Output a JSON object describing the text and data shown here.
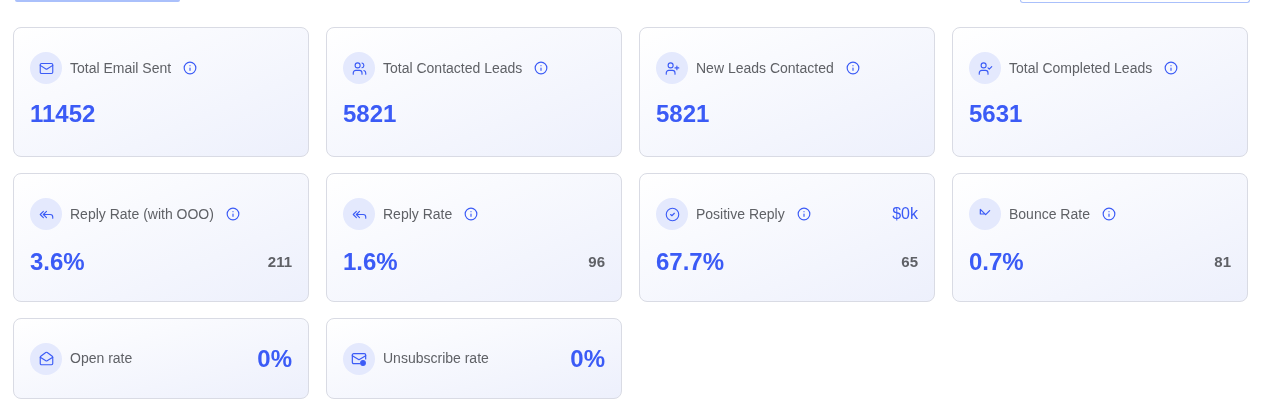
{
  "cards": [
    {
      "kind": "total",
      "label": "Total Email Sent",
      "info": true,
      "value": "11452"
    },
    {
      "kind": "total",
      "label": "Total Contacted Leads",
      "info": true,
      "value": "5821"
    },
    {
      "kind": "total",
      "label": "New Leads Contacted",
      "info": true,
      "value": "5821"
    },
    {
      "kind": "total",
      "label": "Total Completed Leads",
      "info": true,
      "value": "5631"
    },
    {
      "kind": "rate",
      "label": "Reply Rate (with OOO)",
      "info": true,
      "value": "3.6%",
      "count": "211"
    },
    {
      "kind": "rate",
      "label": "Reply Rate",
      "info": true,
      "value": "1.6%",
      "count": "96"
    },
    {
      "kind": "rate",
      "label": "Positive Reply",
      "info": true,
      "value": "67.7%",
      "count": "65",
      "extra": "$0k"
    },
    {
      "kind": "rate",
      "label": "Bounce Rate",
      "info": true,
      "value": "0.7%",
      "count": "81"
    },
    {
      "kind": "compact",
      "label": "Open rate",
      "info": false,
      "value": "0%"
    },
    {
      "kind": "compact",
      "label": "Unsubscribe rate",
      "info": false,
      "value": "0%"
    }
  ]
}
